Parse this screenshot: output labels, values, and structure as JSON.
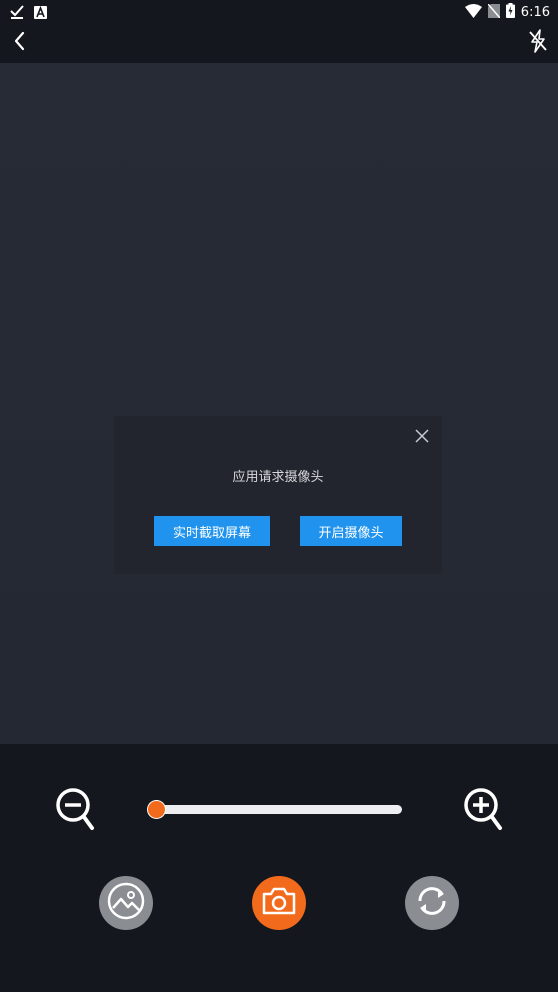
{
  "status_bar": {
    "time": "6:16",
    "icons": [
      "check-notification-icon",
      "a-notification-icon",
      "wifi-icon",
      "no-sim-icon",
      "battery-charging-icon"
    ]
  },
  "top_bar": {
    "back_icon": "chevron-left-icon",
    "flash_icon": "flash-off-icon"
  },
  "dialog": {
    "message": "应用请求摄像头",
    "screen_capture_label": "实时截取屏幕",
    "open_camera_label": "开启摄像头",
    "close_icon": "close-icon"
  },
  "controls": {
    "zoom_level": 0,
    "zoom_out_icon": "zoom-out-icon",
    "zoom_in_icon": "zoom-in-icon",
    "gallery_icon": "image-icon",
    "shutter_icon": "camera-icon",
    "switch_icon": "switch-camera-icon"
  },
  "colors": {
    "accent": "#f26a1b",
    "button_blue": "#1f93ee",
    "background": "#14171d",
    "preview": "#262b35"
  }
}
